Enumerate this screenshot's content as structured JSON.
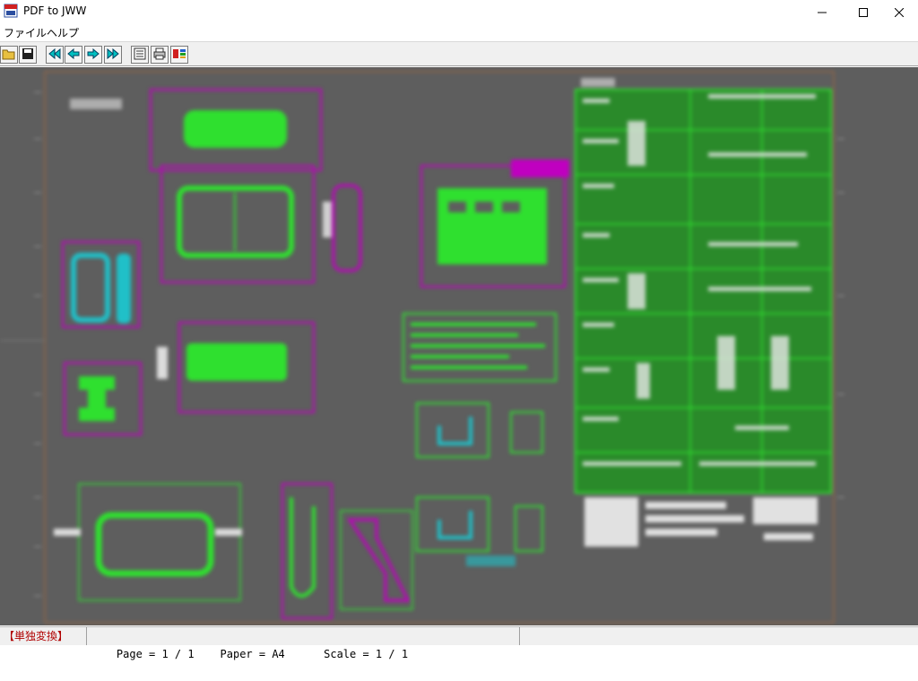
{
  "window": {
    "title": "PDF to JWW"
  },
  "menu": {
    "items": [
      "ファイル",
      "ヘルプ"
    ]
  },
  "status": {
    "mode": "【単独変換】",
    "page": "Page = 1 / 1",
    "paper": "Paper = A4",
    "scale": "Scale = 1 / 1"
  },
  "colors": {
    "canvas_bg": "#5e5e5e",
    "drawing_green": "#2fe02f",
    "dimension_magenta": "#c000c0",
    "accent_cyan": "#20c0c8",
    "status_mode_red": "#b00000"
  },
  "toolbar": {
    "icons": [
      "open-folder-icon",
      "save-icon",
      "first-page-icon",
      "prev-page-icon",
      "next-page-icon",
      "last-page-icon",
      "properties-icon",
      "print-icon",
      "convert-icon"
    ]
  }
}
